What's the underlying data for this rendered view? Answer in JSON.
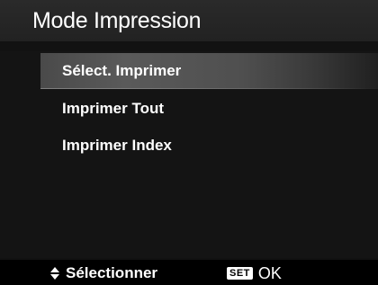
{
  "header": {
    "title": "Mode Impression"
  },
  "menu": {
    "selected_index": 0,
    "items": [
      {
        "label": "Sélect. Imprimer"
      },
      {
        "label": "Imprimer Tout"
      },
      {
        "label": "Imprimer Index"
      }
    ]
  },
  "footer": {
    "navigate_icon": "up-down-arrows-icon",
    "navigate_label": "Sélectionner",
    "set_badge": "SET",
    "confirm_label": "OK"
  }
}
